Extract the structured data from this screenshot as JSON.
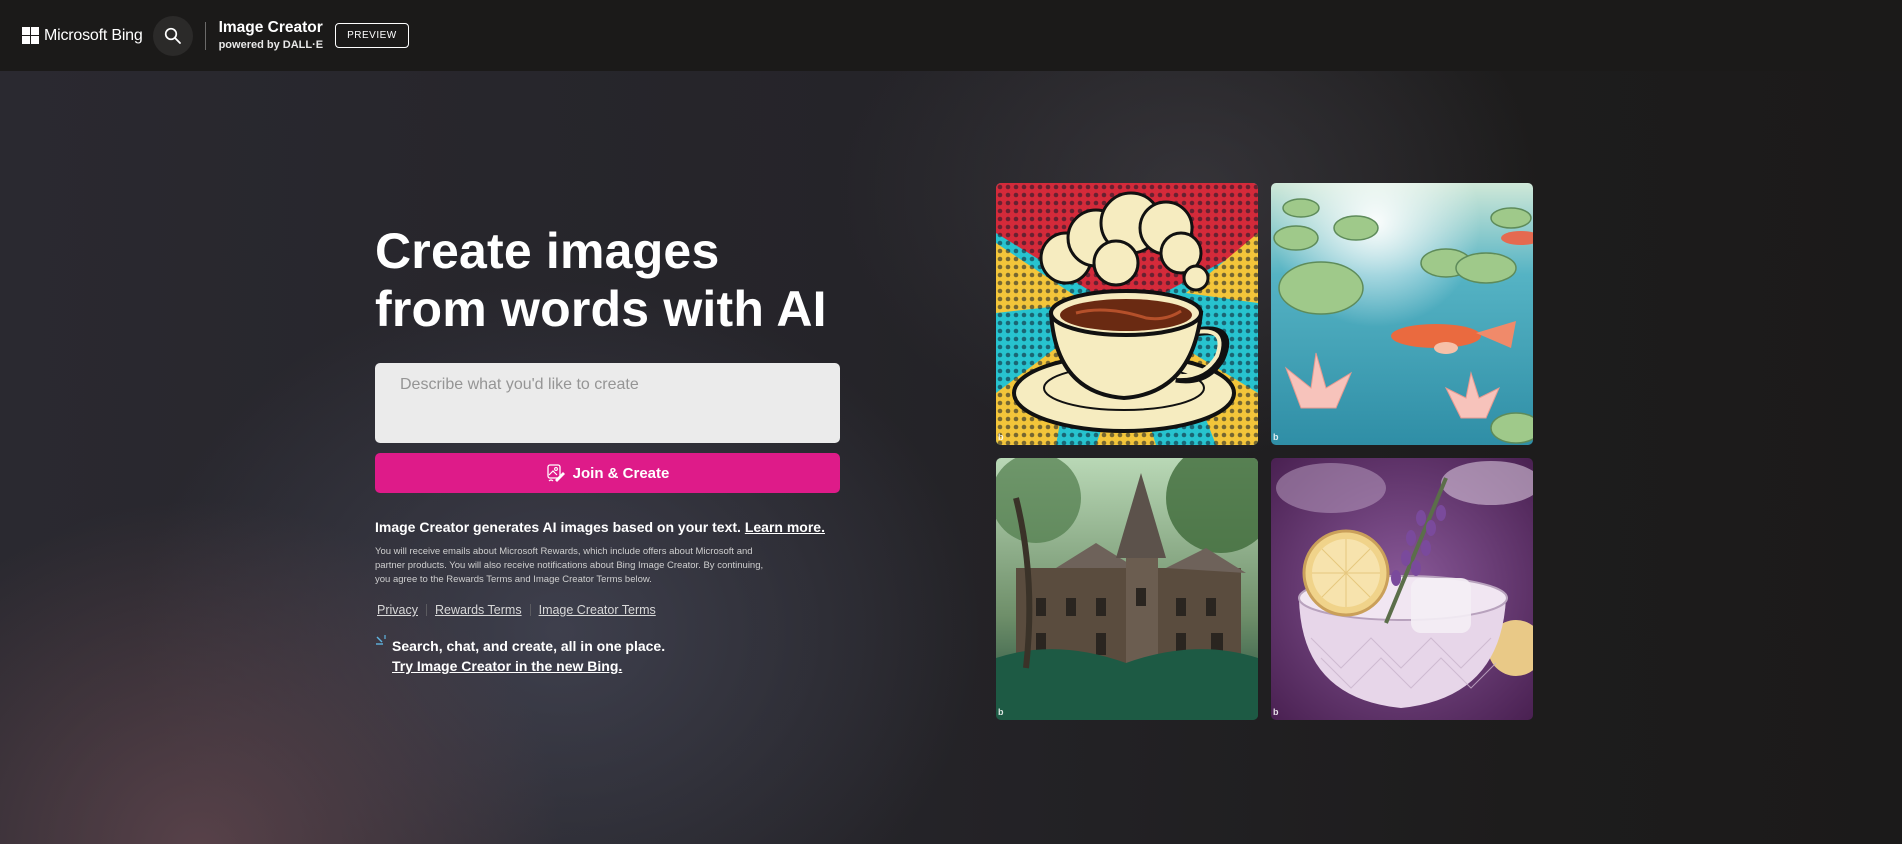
{
  "header": {
    "logo_text": "Microsoft Bing",
    "logo_icon": "windows-grid-icon",
    "search_icon": "search-icon",
    "product_title": "Image Creator",
    "product_subtitle": "powered by DALL·E",
    "badge": "PREVIEW"
  },
  "hero": {
    "title": "Create images from words with AI"
  },
  "prompt": {
    "placeholder": "Describe what you'd like to create",
    "value": ""
  },
  "create_button": {
    "label": "Join & Create",
    "icon": "image-edit-icon",
    "color": "#de1b89"
  },
  "info": {
    "headline": "Image Creator generates AI images based on your text.",
    "learn_more": "Learn more.",
    "fine_print": "You will receive emails about Microsoft Rewards, which include offers about Microsoft and partner products. You will also receive notifications about Bing Image Creator. By continuing, you agree to the Rewards Terms and Image Creator Terms below."
  },
  "links": [
    {
      "label": "Privacy"
    },
    {
      "label": "Rewards Terms"
    },
    {
      "label": "Image Creator Terms"
    }
  ],
  "promo": {
    "icon": "bing-chat-icon",
    "text": "Search, chat, and create, all in one place.",
    "link": "Try Image Creator in the new Bing."
  },
  "gallery": [
    {
      "subject": "pop-art coffee cup with steam cloud",
      "watermark": "b"
    },
    {
      "subject": "watercolor koi pond with lily pads and lotus",
      "watermark": "b"
    },
    {
      "subject": "overgrown gothic mansion in a forest",
      "watermark": "b"
    },
    {
      "subject": "lavender cocktail with lemon slice",
      "watermark": "b"
    }
  ]
}
